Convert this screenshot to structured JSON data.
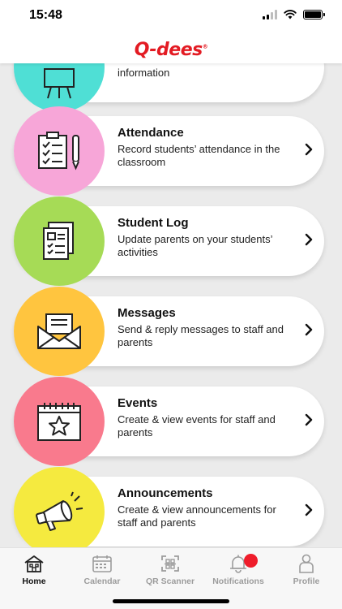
{
  "status_bar": {
    "time": "15:48"
  },
  "header": {
    "logo_text": "Q-dees",
    "logo_mark": "®"
  },
  "menu": [
    {
      "title": "",
      "description": "information",
      "color": "#4fdfd5",
      "icon": "easel-icon"
    },
    {
      "title": "Attendance",
      "description": "Record students’ attendance in the classroom",
      "color": "#f7a6d8",
      "icon": "clipboard-checklist-icon"
    },
    {
      "title": "Student Log",
      "description": "Update parents on your students’ activities",
      "color": "#a6db56",
      "icon": "documents-icon"
    },
    {
      "title": "Messages",
      "description": "Send & reply messages to staff and parents",
      "color": "#ffc53f",
      "icon": "envelope-icon"
    },
    {
      "title": "Events",
      "description": "Create & view events for staff and parents",
      "color": "#f97a8d",
      "icon": "calendar-star-icon"
    },
    {
      "title": "Announcements",
      "description": "Create & view announcements for staff and parents",
      "color": "#f5ea3f",
      "icon": "megaphone-icon"
    }
  ],
  "tabs": [
    {
      "label": "Home",
      "icon": "home-icon",
      "active": true
    },
    {
      "label": "Calendar",
      "icon": "calendar-icon",
      "active": false
    },
    {
      "label": "QR Scanner",
      "icon": "qr-scanner-icon",
      "active": false
    },
    {
      "label": "Notifications",
      "icon": "bell-icon",
      "active": false
    },
    {
      "label": "Profile",
      "icon": "person-icon",
      "active": false
    }
  ],
  "colors": {
    "brand": "#e31b23",
    "badge": "#ef1d2b",
    "inactive_tab": "#9c9c9c"
  }
}
